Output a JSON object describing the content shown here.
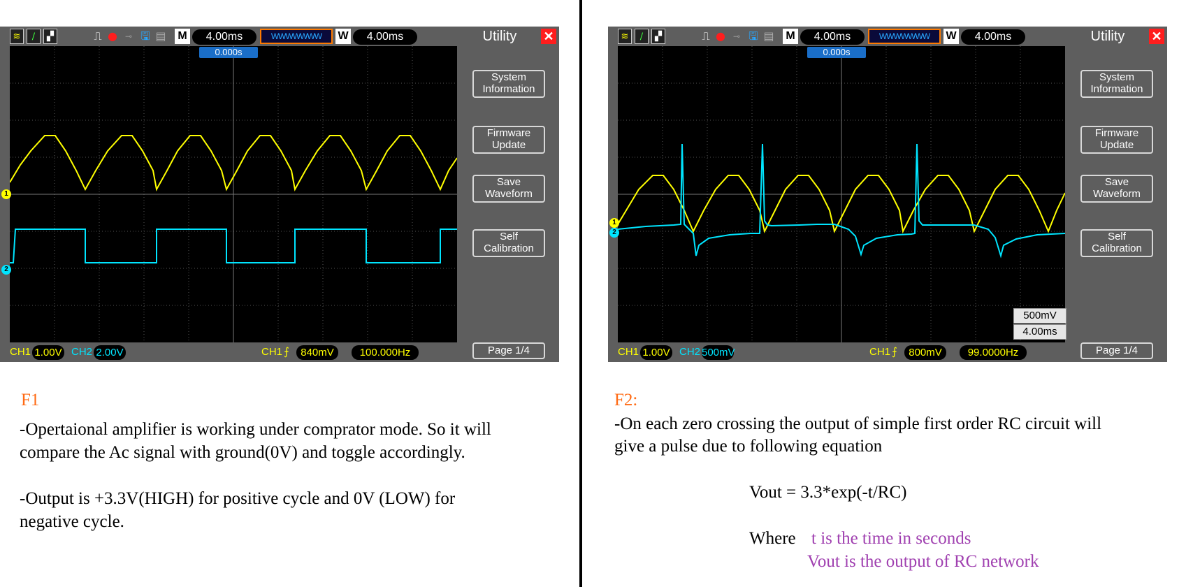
{
  "left_panel": {
    "scope": {
      "m_label": "M",
      "timebase": "4.00ms",
      "w_label": "W",
      "window_time": "4.00ms",
      "memory_label": "WWWWWWW",
      "menu_title": "Utility",
      "close": "✕",
      "trigger_position": "0.000s",
      "menu": [
        "System\nInformation",
        "Firmware\nUpdate",
        "Save\nWaveform",
        "Self\nCalibration"
      ],
      "page": "Page 1/4",
      "ch1_label": "CH1",
      "ch1_scale": "1.00V",
      "ch2_label": "CH2",
      "ch2_scale": "2.00V",
      "trig_ch": "CH1",
      "trig_level": "840mV",
      "frequency": "100.000Hz",
      "marker1": "1",
      "marker2": "2"
    },
    "caption_title": "F1",
    "caption_lines": [
      "-Opertaional amplifier is working under comprator mode. So it will",
      "compare the Ac signal with ground(0V) and toggle accordingly.",
      "-Output is +3.3V(HIGH) for positive cycle and 0V (LOW) for",
      "negative cycle."
    ]
  },
  "right_panel": {
    "scope": {
      "m_label": "M",
      "timebase": "4.00ms",
      "w_label": "W",
      "window_time": "4.00ms",
      "memory_label": "WWWWWWW",
      "menu_title": "Utility",
      "close": "✕",
      "trigger_position": "0.000s",
      "menu": [
        "System\nInformation",
        "Firmware\nUpdate",
        "Save\nWaveform",
        "Self\nCalibration"
      ],
      "page": "Page 1/4",
      "ch1_label": "CH1",
      "ch1_scale": "1.00V",
      "ch2_label": "CH2",
      "ch2_scale": "500mV",
      "trig_ch": "CH1",
      "trig_level": "800mV",
      "frequency": "99.0000Hz",
      "scale_v": "500mV",
      "scale_t": "4.00ms",
      "marker1": "1",
      "marker2": "2"
    },
    "caption_title": "F2:",
    "caption_lines": [
      "-On each zero crossing the output of simple first order RC circuit will",
      "give a pulse due to following equation"
    ],
    "equation": "Vout = 3.3*exp(-t/RC)",
    "where_label": "Where",
    "where_items": [
      "t is the time in  seconds",
      "Vout is the output of RC network"
    ]
  },
  "colors": {
    "ch1": "#ffff00",
    "ch2": "#00e5ff",
    "accent_close": "#ff1e1e",
    "caption_title": "#ff6a13",
    "where_text": "#a040b0"
  }
}
